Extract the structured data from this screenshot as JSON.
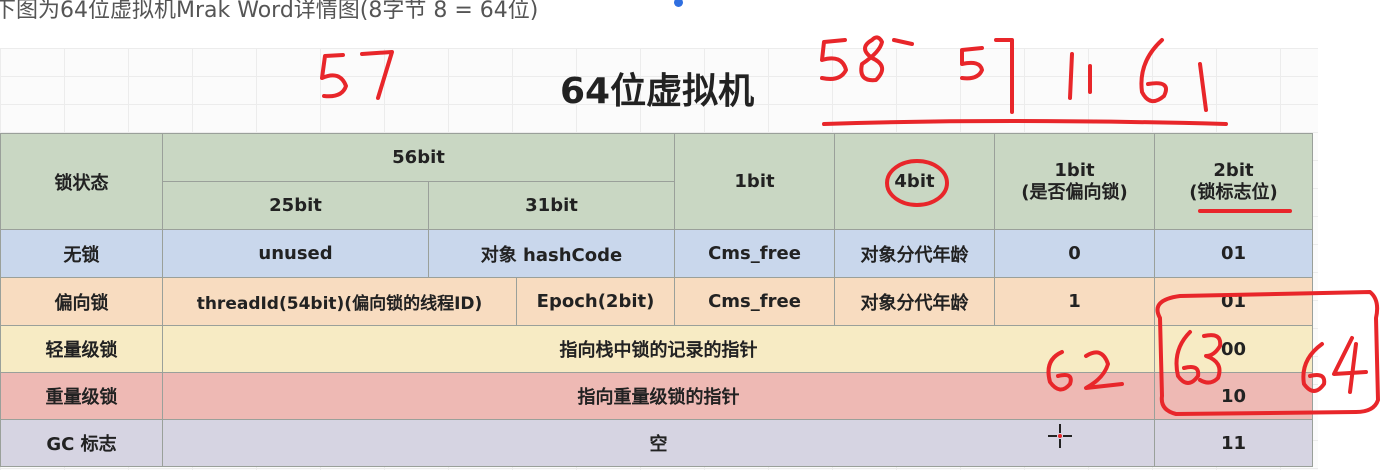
{
  "caption": "下图为64位虚拟机Mrak Word详情图(8字节 8 = 64位)",
  "title": "64位虚拟机",
  "header": {
    "lock_state": "锁状态",
    "bits56": "56bit",
    "bits25": "25bit",
    "bits31": "31bit",
    "bit1": "1bit",
    "bits4": "4bit",
    "biased_line1": "1bit",
    "biased_line2": "(是否偏向锁)",
    "flag_line1": "2bit",
    "flag_line2": "(锁标志位)"
  },
  "rows": [
    {
      "state": "无锁",
      "c1": "unused",
      "c2": "对象 hashCode",
      "c3": "Cms_free",
      "c4": "对象分代年龄",
      "c5": "0",
      "flag": "01"
    },
    {
      "state": "偏向锁",
      "c1": "threadId(54bit)(偏向锁的线程ID)",
      "c2": "Epoch(2bit)",
      "c3": "Cms_free",
      "c4": "对象分代年龄",
      "c5": "1",
      "flag": "01"
    },
    {
      "state": "轻量级锁",
      "span": "指向栈中锁的记录的指针",
      "flag": "00"
    },
    {
      "state": "重量级锁",
      "span": "指向重量级锁的指针",
      "flag": "10"
    },
    {
      "state": "GC 标志",
      "span": "空",
      "flag": "11"
    }
  ],
  "colors": {
    "header": "#c9d7c3",
    "row_unlocked": "#c9d7ec",
    "row_biased": "#f8dcc0",
    "row_lightweight": "#f7ebc4",
    "row_heavyweight": "#eeb9b4",
    "row_gc": "#d6d4e2",
    "annotation_ink": "#e8262a"
  },
  "icons": [
    "crosshair-cursor-icon"
  ]
}
